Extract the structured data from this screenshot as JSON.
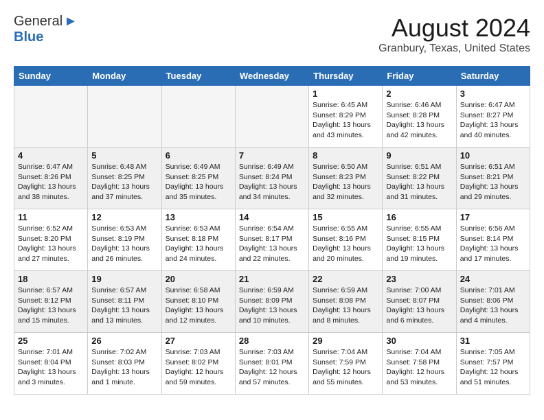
{
  "header": {
    "logo_general": "General",
    "logo_blue": "Blue",
    "month": "August 2024",
    "location": "Granbury, Texas, United States"
  },
  "weekdays": [
    "Sunday",
    "Monday",
    "Tuesday",
    "Wednesday",
    "Thursday",
    "Friday",
    "Saturday"
  ],
  "weeks": [
    [
      {
        "day": "",
        "info": ""
      },
      {
        "day": "",
        "info": ""
      },
      {
        "day": "",
        "info": ""
      },
      {
        "day": "",
        "info": ""
      },
      {
        "day": "1",
        "info": "Sunrise: 6:45 AM\nSunset: 8:29 PM\nDaylight: 13 hours\nand 43 minutes."
      },
      {
        "day": "2",
        "info": "Sunrise: 6:46 AM\nSunset: 8:28 PM\nDaylight: 13 hours\nand 42 minutes."
      },
      {
        "day": "3",
        "info": "Sunrise: 6:47 AM\nSunset: 8:27 PM\nDaylight: 13 hours\nand 40 minutes."
      }
    ],
    [
      {
        "day": "4",
        "info": "Sunrise: 6:47 AM\nSunset: 8:26 PM\nDaylight: 13 hours\nand 38 minutes."
      },
      {
        "day": "5",
        "info": "Sunrise: 6:48 AM\nSunset: 8:25 PM\nDaylight: 13 hours\nand 37 minutes."
      },
      {
        "day": "6",
        "info": "Sunrise: 6:49 AM\nSunset: 8:25 PM\nDaylight: 13 hours\nand 35 minutes."
      },
      {
        "day": "7",
        "info": "Sunrise: 6:49 AM\nSunset: 8:24 PM\nDaylight: 13 hours\nand 34 minutes."
      },
      {
        "day": "8",
        "info": "Sunrise: 6:50 AM\nSunset: 8:23 PM\nDaylight: 13 hours\nand 32 minutes."
      },
      {
        "day": "9",
        "info": "Sunrise: 6:51 AM\nSunset: 8:22 PM\nDaylight: 13 hours\nand 31 minutes."
      },
      {
        "day": "10",
        "info": "Sunrise: 6:51 AM\nSunset: 8:21 PM\nDaylight: 13 hours\nand 29 minutes."
      }
    ],
    [
      {
        "day": "11",
        "info": "Sunrise: 6:52 AM\nSunset: 8:20 PM\nDaylight: 13 hours\nand 27 minutes."
      },
      {
        "day": "12",
        "info": "Sunrise: 6:53 AM\nSunset: 8:19 PM\nDaylight: 13 hours\nand 26 minutes."
      },
      {
        "day": "13",
        "info": "Sunrise: 6:53 AM\nSunset: 8:18 PM\nDaylight: 13 hours\nand 24 minutes."
      },
      {
        "day": "14",
        "info": "Sunrise: 6:54 AM\nSunset: 8:17 PM\nDaylight: 13 hours\nand 22 minutes."
      },
      {
        "day": "15",
        "info": "Sunrise: 6:55 AM\nSunset: 8:16 PM\nDaylight: 13 hours\nand 20 minutes."
      },
      {
        "day": "16",
        "info": "Sunrise: 6:55 AM\nSunset: 8:15 PM\nDaylight: 13 hours\nand 19 minutes."
      },
      {
        "day": "17",
        "info": "Sunrise: 6:56 AM\nSunset: 8:14 PM\nDaylight: 13 hours\nand 17 minutes."
      }
    ],
    [
      {
        "day": "18",
        "info": "Sunrise: 6:57 AM\nSunset: 8:12 PM\nDaylight: 13 hours\nand 15 minutes."
      },
      {
        "day": "19",
        "info": "Sunrise: 6:57 AM\nSunset: 8:11 PM\nDaylight: 13 hours\nand 13 minutes."
      },
      {
        "day": "20",
        "info": "Sunrise: 6:58 AM\nSunset: 8:10 PM\nDaylight: 13 hours\nand 12 minutes."
      },
      {
        "day": "21",
        "info": "Sunrise: 6:59 AM\nSunset: 8:09 PM\nDaylight: 13 hours\nand 10 minutes."
      },
      {
        "day": "22",
        "info": "Sunrise: 6:59 AM\nSunset: 8:08 PM\nDaylight: 13 hours\nand 8 minutes."
      },
      {
        "day": "23",
        "info": "Sunrise: 7:00 AM\nSunset: 8:07 PM\nDaylight: 13 hours\nand 6 minutes."
      },
      {
        "day": "24",
        "info": "Sunrise: 7:01 AM\nSunset: 8:06 PM\nDaylight: 13 hours\nand 4 minutes."
      }
    ],
    [
      {
        "day": "25",
        "info": "Sunrise: 7:01 AM\nSunset: 8:04 PM\nDaylight: 13 hours\nand 3 minutes."
      },
      {
        "day": "26",
        "info": "Sunrise: 7:02 AM\nSunset: 8:03 PM\nDaylight: 13 hours\nand 1 minute."
      },
      {
        "day": "27",
        "info": "Sunrise: 7:03 AM\nSunset: 8:02 PM\nDaylight: 12 hours\nand 59 minutes."
      },
      {
        "day": "28",
        "info": "Sunrise: 7:03 AM\nSunset: 8:01 PM\nDaylight: 12 hours\nand 57 minutes."
      },
      {
        "day": "29",
        "info": "Sunrise: 7:04 AM\nSunset: 7:59 PM\nDaylight: 12 hours\nand 55 minutes."
      },
      {
        "day": "30",
        "info": "Sunrise: 7:04 AM\nSunset: 7:58 PM\nDaylight: 12 hours\nand 53 minutes."
      },
      {
        "day": "31",
        "info": "Sunrise: 7:05 AM\nSunset: 7:57 PM\nDaylight: 12 hours\nand 51 minutes."
      }
    ]
  ]
}
